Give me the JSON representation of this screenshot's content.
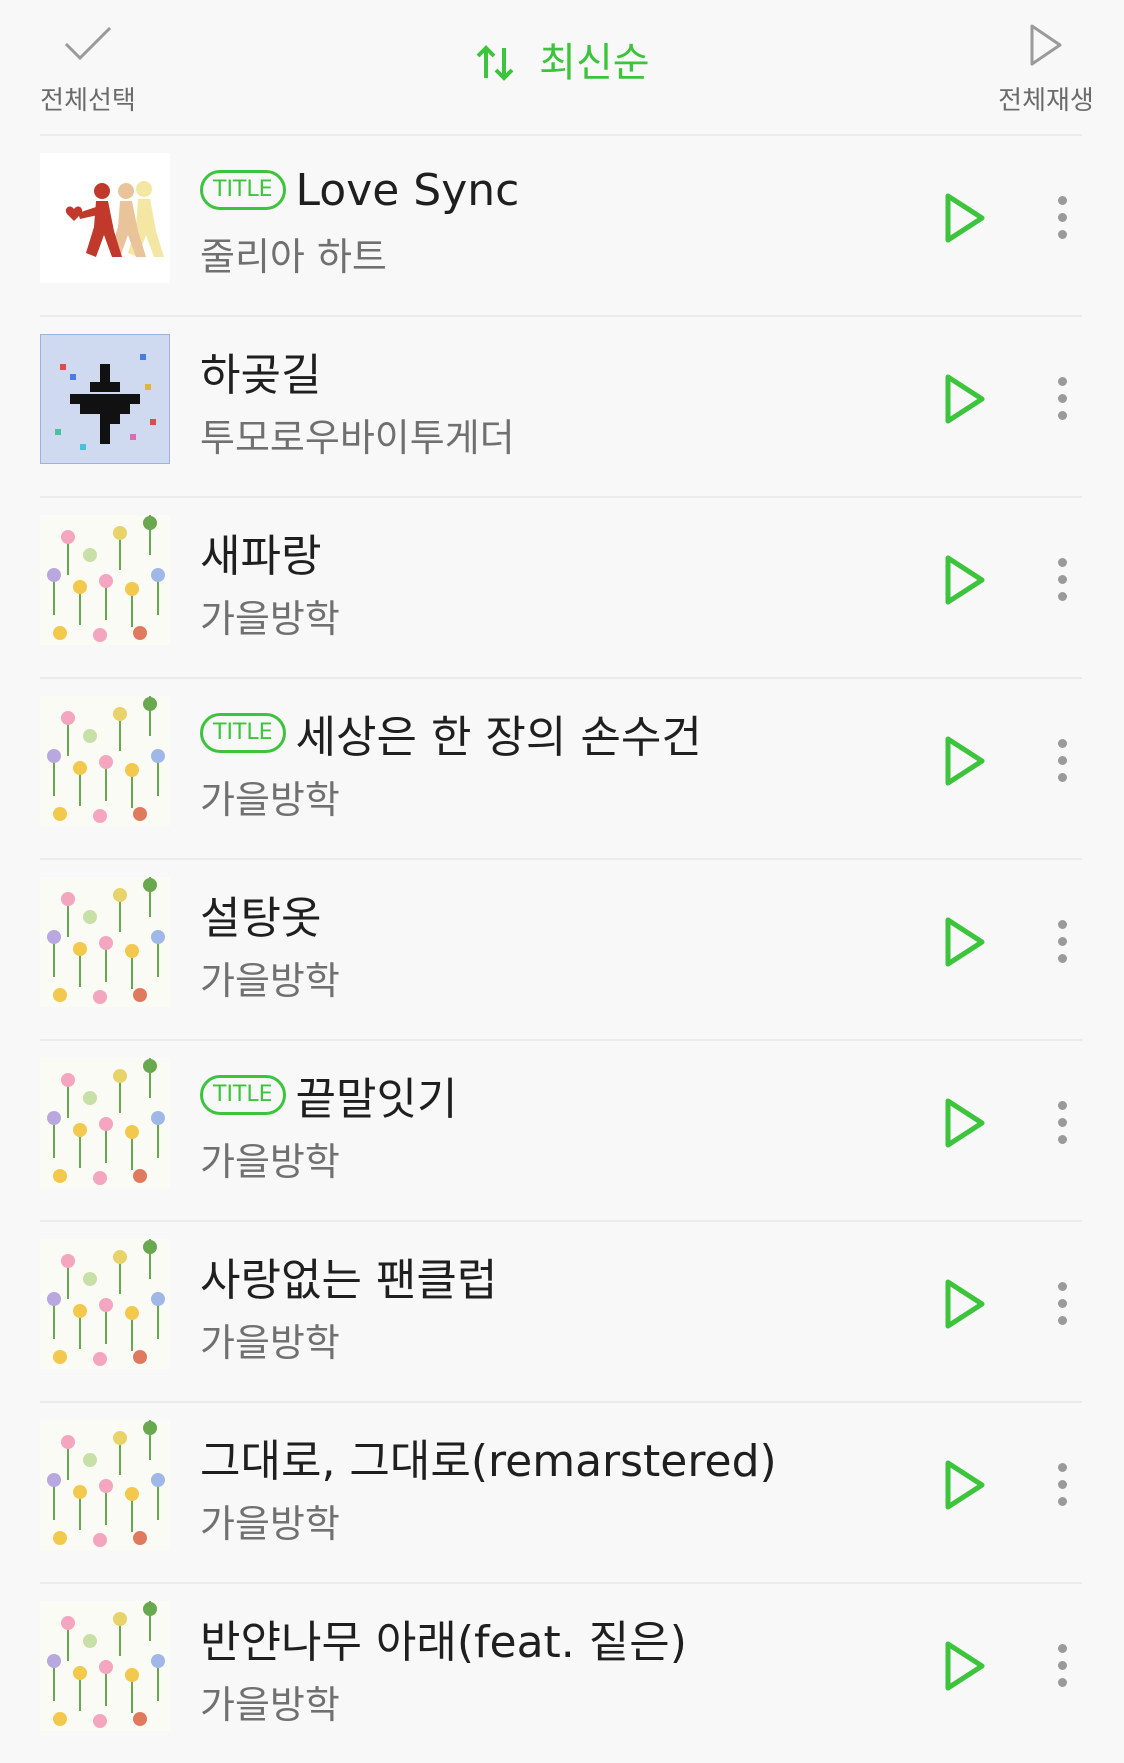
{
  "header": {
    "select_all_label": "전체선택",
    "sort_label": "최신순",
    "play_all_label": "전체재생"
  },
  "colors": {
    "accent": "#3cc43c"
  },
  "tracks": [
    {
      "title": "Love Sync",
      "artist": "줄리아 하트",
      "badge": "TITLE",
      "art": "runners"
    },
    {
      "title": "하곶길",
      "artist": "투모로우바이투게더",
      "badge": "",
      "art": "pixel"
    },
    {
      "title": "새파랑",
      "artist": "가을방학",
      "badge": "",
      "art": "flowers"
    },
    {
      "title": "세상은 한 장의 손수건",
      "artist": "가을방학",
      "badge": "TITLE",
      "art": "flowers"
    },
    {
      "title": "설탕옷",
      "artist": "가을방학",
      "badge": "",
      "art": "flowers"
    },
    {
      "title": "끝말잇기",
      "artist": "가을방학",
      "badge": "TITLE",
      "art": "flowers"
    },
    {
      "title": "사랑없는 팬클럽",
      "artist": "가을방학",
      "badge": "",
      "art": "flowers"
    },
    {
      "title": "그대로, 그대로(remarstered)",
      "artist": "가을방학",
      "badge": "",
      "art": "flowers"
    },
    {
      "title": "반얀나무 아래(feat. 짙은)",
      "artist": "가을방학",
      "badge": "",
      "art": "flowers"
    }
  ]
}
